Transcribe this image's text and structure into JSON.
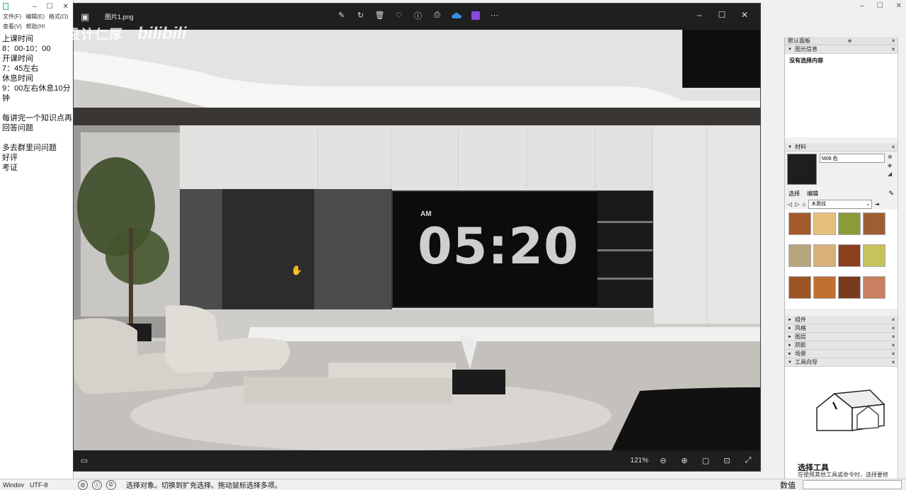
{
  "notepad": {
    "menu": [
      "文件(F)",
      "编辑(E)",
      "格式(O)"
    ],
    "menu2": [
      "查看(V)",
      "帮助(H)"
    ],
    "lines": [
      "上课时间",
      "8：00-10：00",
      "开课时间",
      "7：45左右",
      "休息时间",
      "9：00左右休息10分",
      "钟",
      "",
      "每讲完一个知识点再",
      "回答问题",
      "",
      "多去群里问问题",
      "好评",
      "考证"
    ],
    "status_eol": "Windov",
    "status_encoding": "UTF-8"
  },
  "viewer": {
    "filename": "图片1.png",
    "zoom": "121%",
    "tools": [
      "edit-icon",
      "rotate-icon",
      "delete-icon",
      "favorite-icon",
      "info-icon",
      "print-icon",
      "onedrive-icon",
      "clipchamp-icon",
      "more-icon"
    ],
    "clock": {
      "ampm": "AM",
      "time": "05:20"
    }
  },
  "watermark": {
    "text": "室内设计仁厚",
    "brand": "bilibili"
  },
  "panel": {
    "tray_title": "默认面板",
    "entity_info": {
      "title": "图元信息",
      "content": "没有选择内容"
    },
    "materials": {
      "title": "材料",
      "name": "M08 色",
      "tab_select": "选择",
      "tab_edit": "编辑",
      "library": "木质纹",
      "swatches": [
        "#a45a2c",
        "#e6c07a",
        "#8a9b3c",
        "#9c5f34",
        "#b6a67a",
        "#d9b07a",
        "#8b3f1e",
        "#c7c35c",
        "#9c5427",
        "#c07032",
        "#7a3a1e",
        "#c98060"
      ]
    },
    "sections": [
      "组件",
      "风格",
      "图层",
      "阴影",
      "场景",
      "工具向导"
    ],
    "instructor": {
      "title": "选择工具",
      "text": "在使用其他工具或命令时，选择要修改的图元。"
    }
  },
  "statusbar": {
    "message": "选择对象。切换到扩充选择。拖动鼠标选择多项。",
    "vcb_label": "数值"
  }
}
